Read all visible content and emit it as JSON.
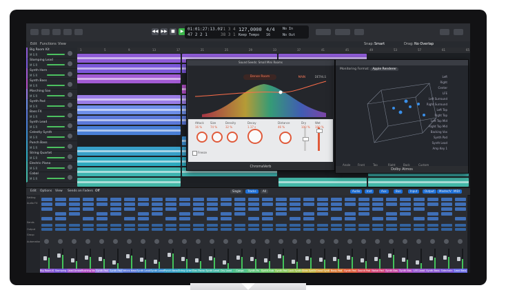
{
  "control_bar": {
    "lcd_position": "01:01:27:13.01",
    "lcd_bars": "47 2 2 1",
    "lcd_beats": "71 3 4",
    "lcd_beats2": "38 3 1",
    "lcd_tempo": "127,0000",
    "lcd_tempo_label": "Keep Tempo",
    "lcd_signature": "4/4",
    "lcd_division": "16",
    "lcd_in": "No In",
    "lcd_out": "No Out",
    "snap_label": "Snap:",
    "snap_value": "Smart",
    "drag_label": "Drag:",
    "drag_value": "No Overlap"
  },
  "tracks_bar": {
    "edit": "Edit",
    "functions": "Functions",
    "view": "View"
  },
  "ruler": [
    "1",
    "5",
    "9",
    "13",
    "17",
    "21",
    "25",
    "29",
    "33",
    "37",
    "41",
    "45",
    "49",
    "53",
    "57",
    "61",
    "65"
  ],
  "tracks": [
    {
      "name": "Big Room Kit",
      "color": "#8e5bd6"
    },
    {
      "name": "Stomping Lead",
      "color": "#7b58d9"
    },
    {
      "name": "Synth Horn",
      "color": "#a25bd4"
    },
    {
      "name": "Synth Bass",
      "color": "#b24fc7"
    },
    {
      "name": "Marching Sax",
      "color": "#9a7de6"
    },
    {
      "name": "Synth Pad",
      "color": "#6d8ee8"
    },
    {
      "name": "Bass FX",
      "color": "#5b78d9"
    },
    {
      "name": "Synth Lead",
      "color": "#4a7fd6"
    },
    {
      "name": "Celestly Synth",
      "color": "#3a8ed0"
    },
    {
      "name": "Punch Bass",
      "color": "#38a0c8"
    },
    {
      "name": "String Quartet",
      "color": "#2eaac0"
    },
    {
      "name": "Electric Piano",
      "color": "#3fb4b0"
    },
    {
      "name": "Cobal",
      "color": "#44b8a8"
    }
  ],
  "chromaverb": {
    "title": "Sound Seeds: Small Mini Rooms",
    "preset": "Dense Room",
    "tab_main": "MAIN",
    "tab_details": "DETAILS",
    "footer": "ChromaVerb",
    "controls": [
      {
        "label": "Attack",
        "value": "16 %"
      },
      {
        "label": "Size",
        "value": "74 %"
      },
      {
        "label": "Density",
        "value": "32 %"
      },
      {
        "label": "Decay",
        "value": "1.17 s"
      },
      {
        "label": "Distance",
        "value": "46 %"
      },
      {
        "label": "Dry",
        "value": "100 %"
      },
      {
        "label": "Wet",
        "value": "100 %"
      }
    ],
    "freeze_label": "Freeze"
  },
  "panner": {
    "format_label": "Monitoring Format:",
    "format_value": "Apple Renderer",
    "footer": "Dolby Atmos",
    "speakers": [
      "Left",
      "Right",
      "Center",
      "LFE",
      "Left Surround",
      "Right Surround",
      "Left Top",
      "Right Top",
      "Left Top Mid",
      "Right Top Mid",
      "Backing Vox",
      "Synth Pad",
      "Synth Lead",
      "Amp Key 1"
    ],
    "tabs": [
      "Angle",
      "Front",
      "Top",
      "Right",
      "Back",
      "Custom"
    ]
  },
  "mixer_bar": {
    "edit": "Edit",
    "options": "Options",
    "view": "View",
    "sends": "Sends on Faders",
    "off": "Off",
    "single": "Single",
    "tracks": "Tracks",
    "all": "All",
    "filter_tabs": [
      "Audio",
      "Inst",
      "Aux",
      "Bus",
      "Input",
      "Output",
      "Master/VCA",
      "MIDI"
    ]
  },
  "mixer_labels": [
    "Setting",
    "Audio FX",
    "Sends",
    "Output",
    "Group",
    "Automation"
  ],
  "channels": [
    {
      "name": "Big Room Kit",
      "color": "#8e5bd6",
      "level": 0.55
    },
    {
      "name": "Stomping",
      "color": "#7b58d9",
      "level": 0.7
    },
    {
      "name": "Lead Arrow",
      "color": "#a25bd4",
      "level": 0.4
    },
    {
      "name": "Rushing Vox",
      "color": "#b24fc7",
      "level": 0.6
    },
    {
      "name": "Synth Pad",
      "color": "#9a7de6",
      "level": 0.5
    },
    {
      "name": "Synth Pad",
      "color": "#6d8ee8",
      "level": 0.3
    },
    {
      "name": "Velcro Bass",
      "color": "#5b78d9",
      "level": 0.65
    },
    {
      "name": "Synth Lead",
      "color": "#4a7fd6",
      "level": 0.45
    },
    {
      "name": "Synth Lead",
      "color": "#3a8ed0",
      "level": 0.35
    },
    {
      "name": "Punch Bass",
      "color": "#38a0c8",
      "level": 0.75
    },
    {
      "name": "String Qrtet",
      "color": "#2eaac0",
      "level": 0.5
    },
    {
      "name": "Elec Piano",
      "color": "#3fb4b0",
      "level": 0.4
    },
    {
      "name": "Synth Lead",
      "color": "#44b8a8",
      "level": 0.55
    },
    {
      "name": "Dry Lead",
      "color": "#4bbf9c",
      "level": 0.3
    },
    {
      "name": "Congo",
      "color": "#55c48e",
      "level": 0.6
    },
    {
      "name": "Synth Pa",
      "color": "#62c97f",
      "level": 0.5
    },
    {
      "name": "Synth Hub",
      "color": "#74cd6f",
      "level": 0.4
    },
    {
      "name": "Synth Pad",
      "color": "#8ac95f",
      "level": 0.65
    },
    {
      "name": "Lock Synth",
      "color": "#a0c452",
      "level": 0.35
    },
    {
      "name": "Slide Synth",
      "color": "#c9b744",
      "level": 0.55
    },
    {
      "name": "Ghost Synth",
      "color": "#d69f3c",
      "level": 0.45
    },
    {
      "name": "Body Pad",
      "color": "#de7f3c",
      "level": 0.5
    },
    {
      "name": "Synth Pad",
      "color": "#e0613f",
      "level": 0.6
    },
    {
      "name": "Sound Pad",
      "color": "#dc4f58",
      "level": 0.4
    },
    {
      "name": "Noise Pad",
      "color": "#d5477a",
      "level": 0.5
    },
    {
      "name": "Synth Bas",
      "color": "#c94aa0",
      "level": 0.7
    },
    {
      "name": "Synth Bas",
      "color": "#b24fc7",
      "level": 0.45
    },
    {
      "name": "LFE Lead",
      "color": "#9a5bd4",
      "level": 0.3
    },
    {
      "name": "Synth Bass",
      "color": "#8e5bd6",
      "level": 0.55
    },
    {
      "name": "Sidechain",
      "color": "#7b58d9",
      "level": 0.6
    },
    {
      "name": "Lead Bass",
      "color": "#6d6ee8",
      "level": 0.5
    }
  ]
}
